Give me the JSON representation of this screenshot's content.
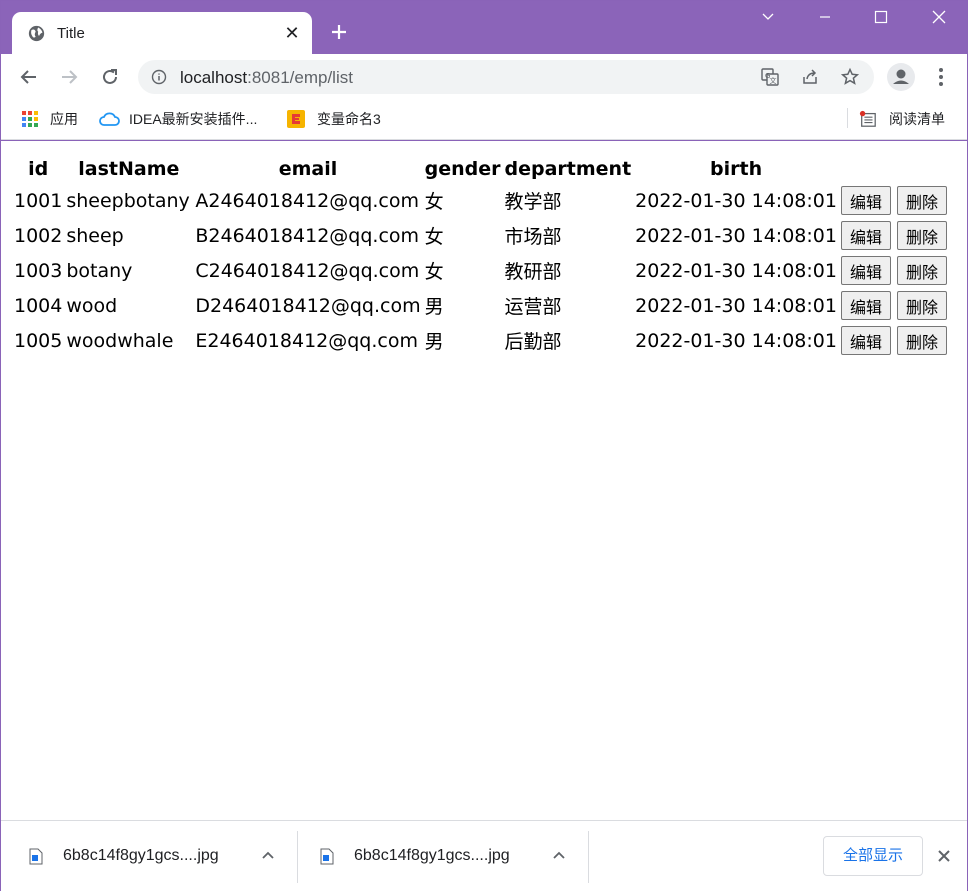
{
  "browser": {
    "tab": {
      "title": "Title"
    },
    "address": {
      "host": "localhost",
      "port_path": ":8081/emp/list"
    },
    "bookmarks": [
      {
        "label": "应用",
        "icon": "apps-grid-icon"
      },
      {
        "label": "IDEA最新安装插件...",
        "icon": "cloud-icon"
      },
      {
        "label": "变量命名3",
        "icon": "bookmark-app-icon"
      }
    ],
    "reading_list": "阅读清单"
  },
  "table": {
    "headers": [
      "id",
      "lastName",
      "email",
      "gender",
      "department",
      "birth"
    ],
    "rows": [
      {
        "id": "1001",
        "lastName": "sheepbotany",
        "email": "A2464018412@qq.com",
        "gender": "女",
        "department": "教学部",
        "birth": "2022-01-30 14:08:01"
      },
      {
        "id": "1002",
        "lastName": "sheep",
        "email": "B2464018412@qq.com",
        "gender": "女",
        "department": "市场部",
        "birth": "2022-01-30 14:08:01"
      },
      {
        "id": "1003",
        "lastName": "botany",
        "email": "C2464018412@qq.com",
        "gender": "女",
        "department": "教研部",
        "birth": "2022-01-30 14:08:01"
      },
      {
        "id": "1004",
        "lastName": "wood",
        "email": "D2464018412@qq.com",
        "gender": "男",
        "department": "运营部",
        "birth": "2022-01-30 14:08:01"
      },
      {
        "id": "1005",
        "lastName": "woodwhale",
        "email": "E2464018412@qq.com",
        "gender": "男",
        "department": "后勤部",
        "birth": "2022-01-30 14:08:01"
      }
    ],
    "edit_label": "编辑",
    "delete_label": "删除"
  },
  "downloads": {
    "items": [
      {
        "name": "6b8c14f8gy1gcs....jpg"
      },
      {
        "name": "6b8c14f8gy1gcs....jpg"
      }
    ],
    "show_all": "全部显示"
  },
  "colors": {
    "titlebar": "#8b64b9",
    "link_blue": "#1a73e8"
  }
}
